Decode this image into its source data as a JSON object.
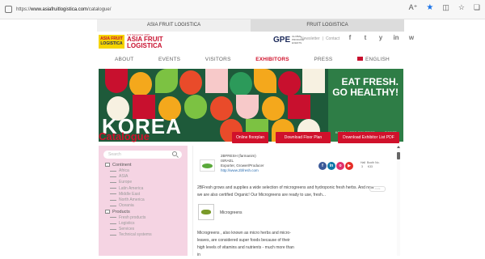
{
  "browser": {
    "url_prefix": "https://",
    "url_domain": "www.asiafruitlogistica.com",
    "url_path": "/catalogue/"
  },
  "event_tabs": [
    {
      "label": "ASIA FRUIT LOGISTICA",
      "active": true
    },
    {
      "label": "FRUIT LOGISTICA",
      "active": false
    }
  ],
  "logo": {
    "mini_line1": "ASIA FRUIT",
    "mini_line2": "LOGISTICA",
    "tagline": "3–5 September 2025",
    "line1": "ASIA FRUIT",
    "line2": "LOGISTICA"
  },
  "partner": {
    "mark": "GPE",
    "text1": "GLOBAL",
    "text2": "PRODUCE",
    "text3": "EVENTS"
  },
  "toplinks": [
    "Newsletter",
    "|",
    "Contact"
  ],
  "social": [
    "f",
    "t",
    "y",
    "in",
    "w"
  ],
  "nav": [
    {
      "label": "ABOUT",
      "active": false
    },
    {
      "label": "EVENTS",
      "active": false
    },
    {
      "label": "VISITORS",
      "active": false
    },
    {
      "label": "EXHIBITORS",
      "active": true
    },
    {
      "label": "PRESS",
      "active": false
    },
    {
      "label": "ENGLISH",
      "active": false
    }
  ],
  "banner": {
    "headline1": "EAT FRESH.",
    "headline2": "GO HEALTHY!",
    "country": "KOREA",
    "small1": "KOREA AGRO-FISHERIES",
    "small2": "aT FOOD"
  },
  "catalogue": {
    "title": "Catalogue",
    "buttons": [
      "Online floorplan",
      "Download Floor Plan",
      "Download Exhibitor List PDF"
    ]
  },
  "sidebar": {
    "search_placeholder": "Search",
    "groups": [
      {
        "label": "Continent",
        "items": [
          "Africa",
          "ASIA",
          "Europe",
          "Latin America",
          "Middle East",
          "North America",
          "Oceania"
        ]
      },
      {
        "label": "Products",
        "items": [
          "Fresh products",
          "Logistics",
          "Services",
          "Technical systems"
        ]
      }
    ]
  },
  "exhibitor": {
    "name": "2BFRESH (farmanim)",
    "country": "ISRAEL",
    "type": "Exporter, Grower/Producer",
    "website": "http://www.2bfresh.com",
    "hall_label": "Hall",
    "booth_label": "Booth No.",
    "hall_value": "3",
    "booth_value": "K33",
    "description": "2BFresh grows and supplies a wide selection of microgreens and hydroponic fresh herbs. And now we are also certified Organic! Our Microgreens are ready to use, fresh...",
    "more_label": "more",
    "product_name": "Microgreens",
    "product_desc": "Microgreens , also known as micro herbs and micro-leaves, are considered super foods because of their high levels of vitamins and nutrients - much more than in"
  },
  "colors": {
    "brand_red": "#d0112b",
    "sidebar_pink": "#f5d4e3",
    "banner_green": "#2e7d46"
  }
}
